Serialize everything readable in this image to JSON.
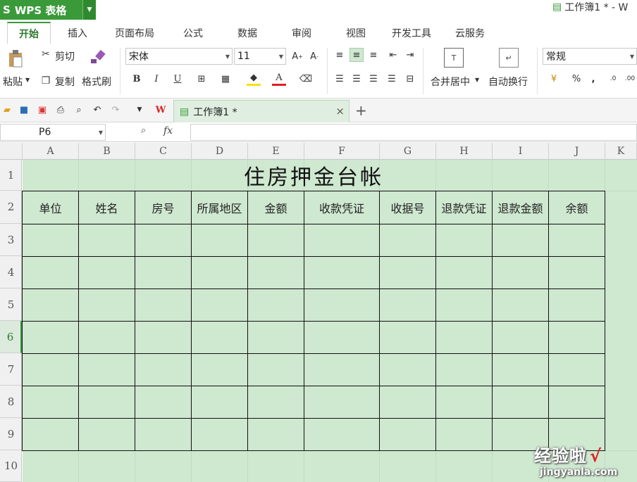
{
  "app": {
    "name": "WPS 表格",
    "window_title": "工作簿1 * - W"
  },
  "tabs": [
    "开始",
    "插入",
    "页面布局",
    "公式",
    "数据",
    "审阅",
    "视图",
    "开发工具",
    "云服务"
  ],
  "ribbon": {
    "paste": "粘贴",
    "cut": "剪切",
    "copy": "复制",
    "format_painter": "格式刷",
    "font_name": "宋体",
    "font_size": "11",
    "bold": "B",
    "italic": "I",
    "underline": "U",
    "merge_center": "合并居中",
    "wrap_text": "自动换行",
    "number_format": "常规",
    "percent": "%",
    "comma": ","
  },
  "doc_tab": {
    "title": "工作簿1 *",
    "close": "×",
    "add": "+"
  },
  "formula_bar": {
    "cell_ref": "P6",
    "fx": "fx",
    "value": ""
  },
  "columns": [
    "A",
    "B",
    "C",
    "D",
    "E",
    "F",
    "G",
    "H",
    "I",
    "J",
    "K"
  ],
  "rows": [
    "1",
    "2",
    "3",
    "4",
    "5",
    "6",
    "7",
    "8",
    "9",
    "10"
  ],
  "sheet": {
    "title": "住房押金台帐",
    "headers": [
      "单位",
      "姓名",
      "房号",
      "所属地区",
      "金额",
      "收款凭证",
      "收据号",
      "退款凭证",
      "退款金额",
      "余额"
    ]
  },
  "watermark": {
    "line1": "经验啦",
    "check": "√",
    "line2": "jingyanla.com"
  }
}
